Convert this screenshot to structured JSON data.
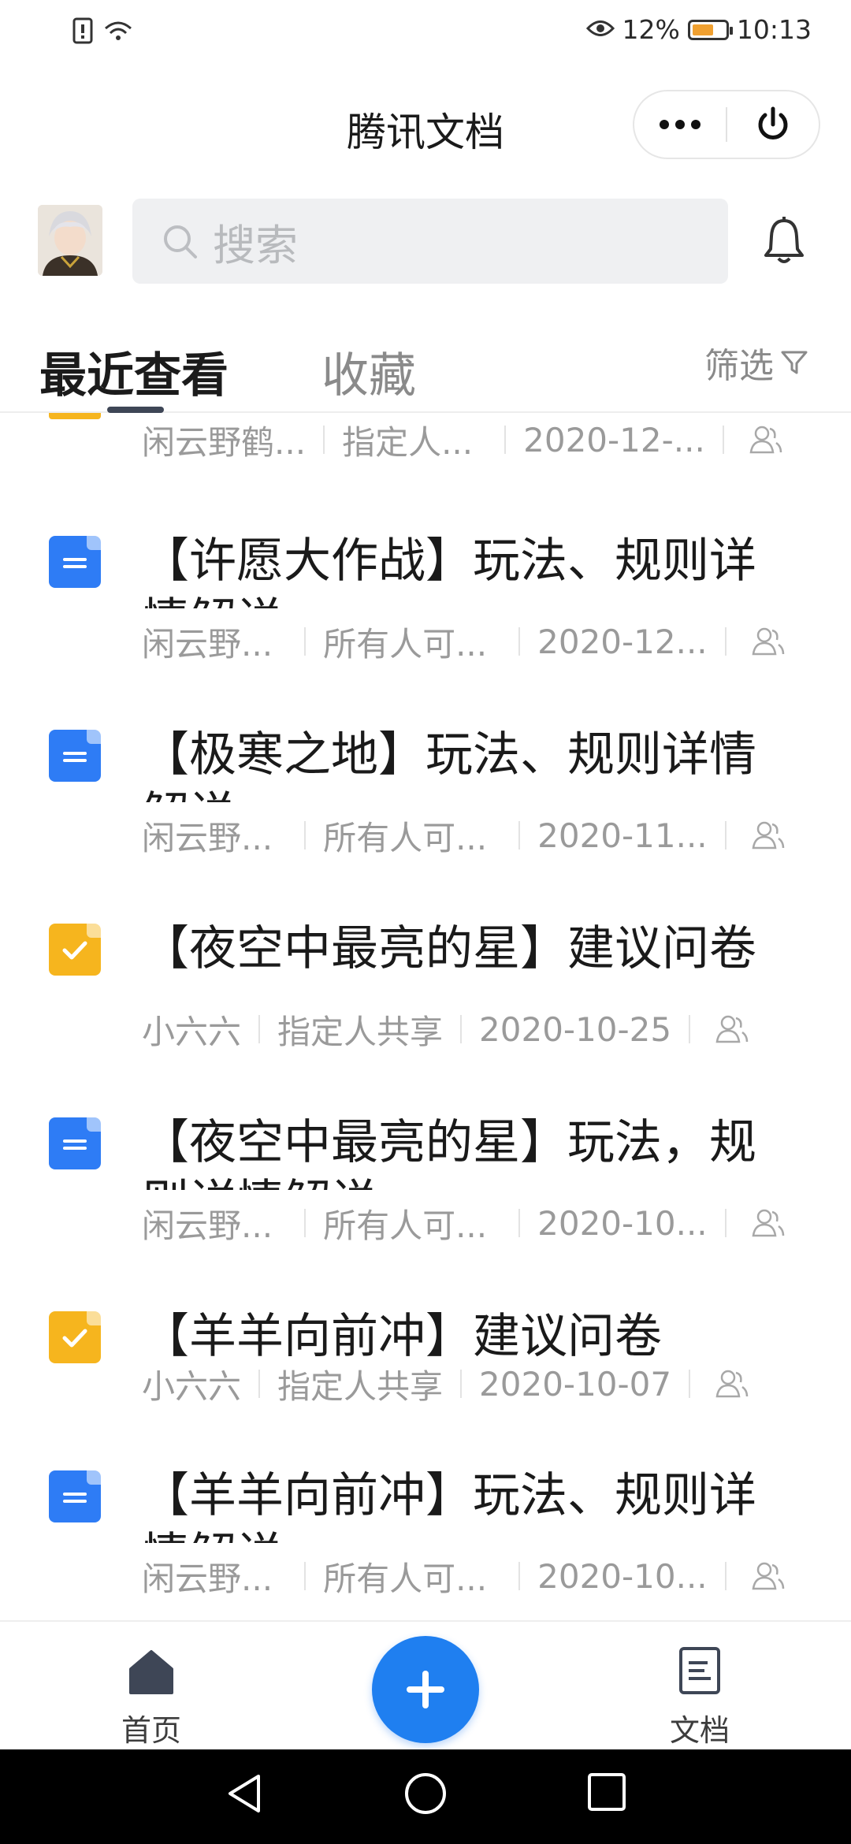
{
  "status_bar": {
    "battery_percent": "12%",
    "time": "10:13"
  },
  "title_bar": {
    "title": "腾讯文档"
  },
  "search": {
    "placeholder": "搜索"
  },
  "tabs": [
    {
      "label": "最近查看",
      "active": true
    },
    {
      "label": "收藏",
      "active": false
    }
  ],
  "filter_label": "筛选",
  "documents": [
    {
      "type": "form",
      "title": "",
      "owner": "闲云野鹤...",
      "sharing": "指定人...",
      "date": "2020-12-..."
    },
    {
      "type": "doc",
      "title": "【许愿大作战】玩法、规则详情解说",
      "owner": "闲云野...",
      "sharing": "所有人可...",
      "date": "2020-12..."
    },
    {
      "type": "doc",
      "title": "【极寒之地】玩法、规则详情解说",
      "owner": "闲云野...",
      "sharing": "所有人可...",
      "date": "2020-11..."
    },
    {
      "type": "form",
      "title": "【夜空中最亮的星】建议问卷",
      "owner": "小六六",
      "sharing": "指定人共享",
      "date": "2020-10-25"
    },
    {
      "type": "doc",
      "title": "【夜空中最亮的星】玩法，规则详情解说",
      "owner": "闲云野...",
      "sharing": "所有人可...",
      "date": "2020-10..."
    },
    {
      "type": "form",
      "title": "【羊羊向前冲】建议问卷",
      "owner": "小六六",
      "sharing": "指定人共享",
      "date": "2020-10-07"
    },
    {
      "type": "doc",
      "title": "【羊羊向前冲】玩法、规则详情解说",
      "owner": "闲云野...",
      "sharing": "所有人可...",
      "date": "2020-10..."
    }
  ],
  "bottom_nav": {
    "home_label": "首页",
    "docs_label": "文档"
  },
  "colors": {
    "accent_blue": "#1f7ff0",
    "doc_icon_blue": "#2e7cf5",
    "form_icon_yellow": "#f6b51e"
  }
}
